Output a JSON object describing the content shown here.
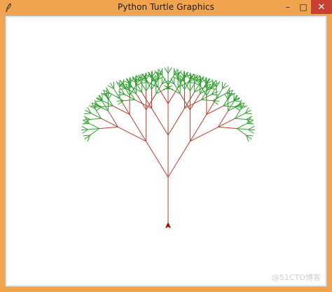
{
  "window": {
    "title": "Python Turtle Graphics",
    "controls": {
      "minimize": "–",
      "maximize": "□",
      "close": "✕"
    },
    "app_icon": "feather-icon"
  },
  "turtle": {
    "heading": "up",
    "pen_colors": {
      "trunk": "#c0392b",
      "leaves": "#2ca02c"
    },
    "cursor_color": "#b00000"
  },
  "watermark": "@51CTO博客"
}
